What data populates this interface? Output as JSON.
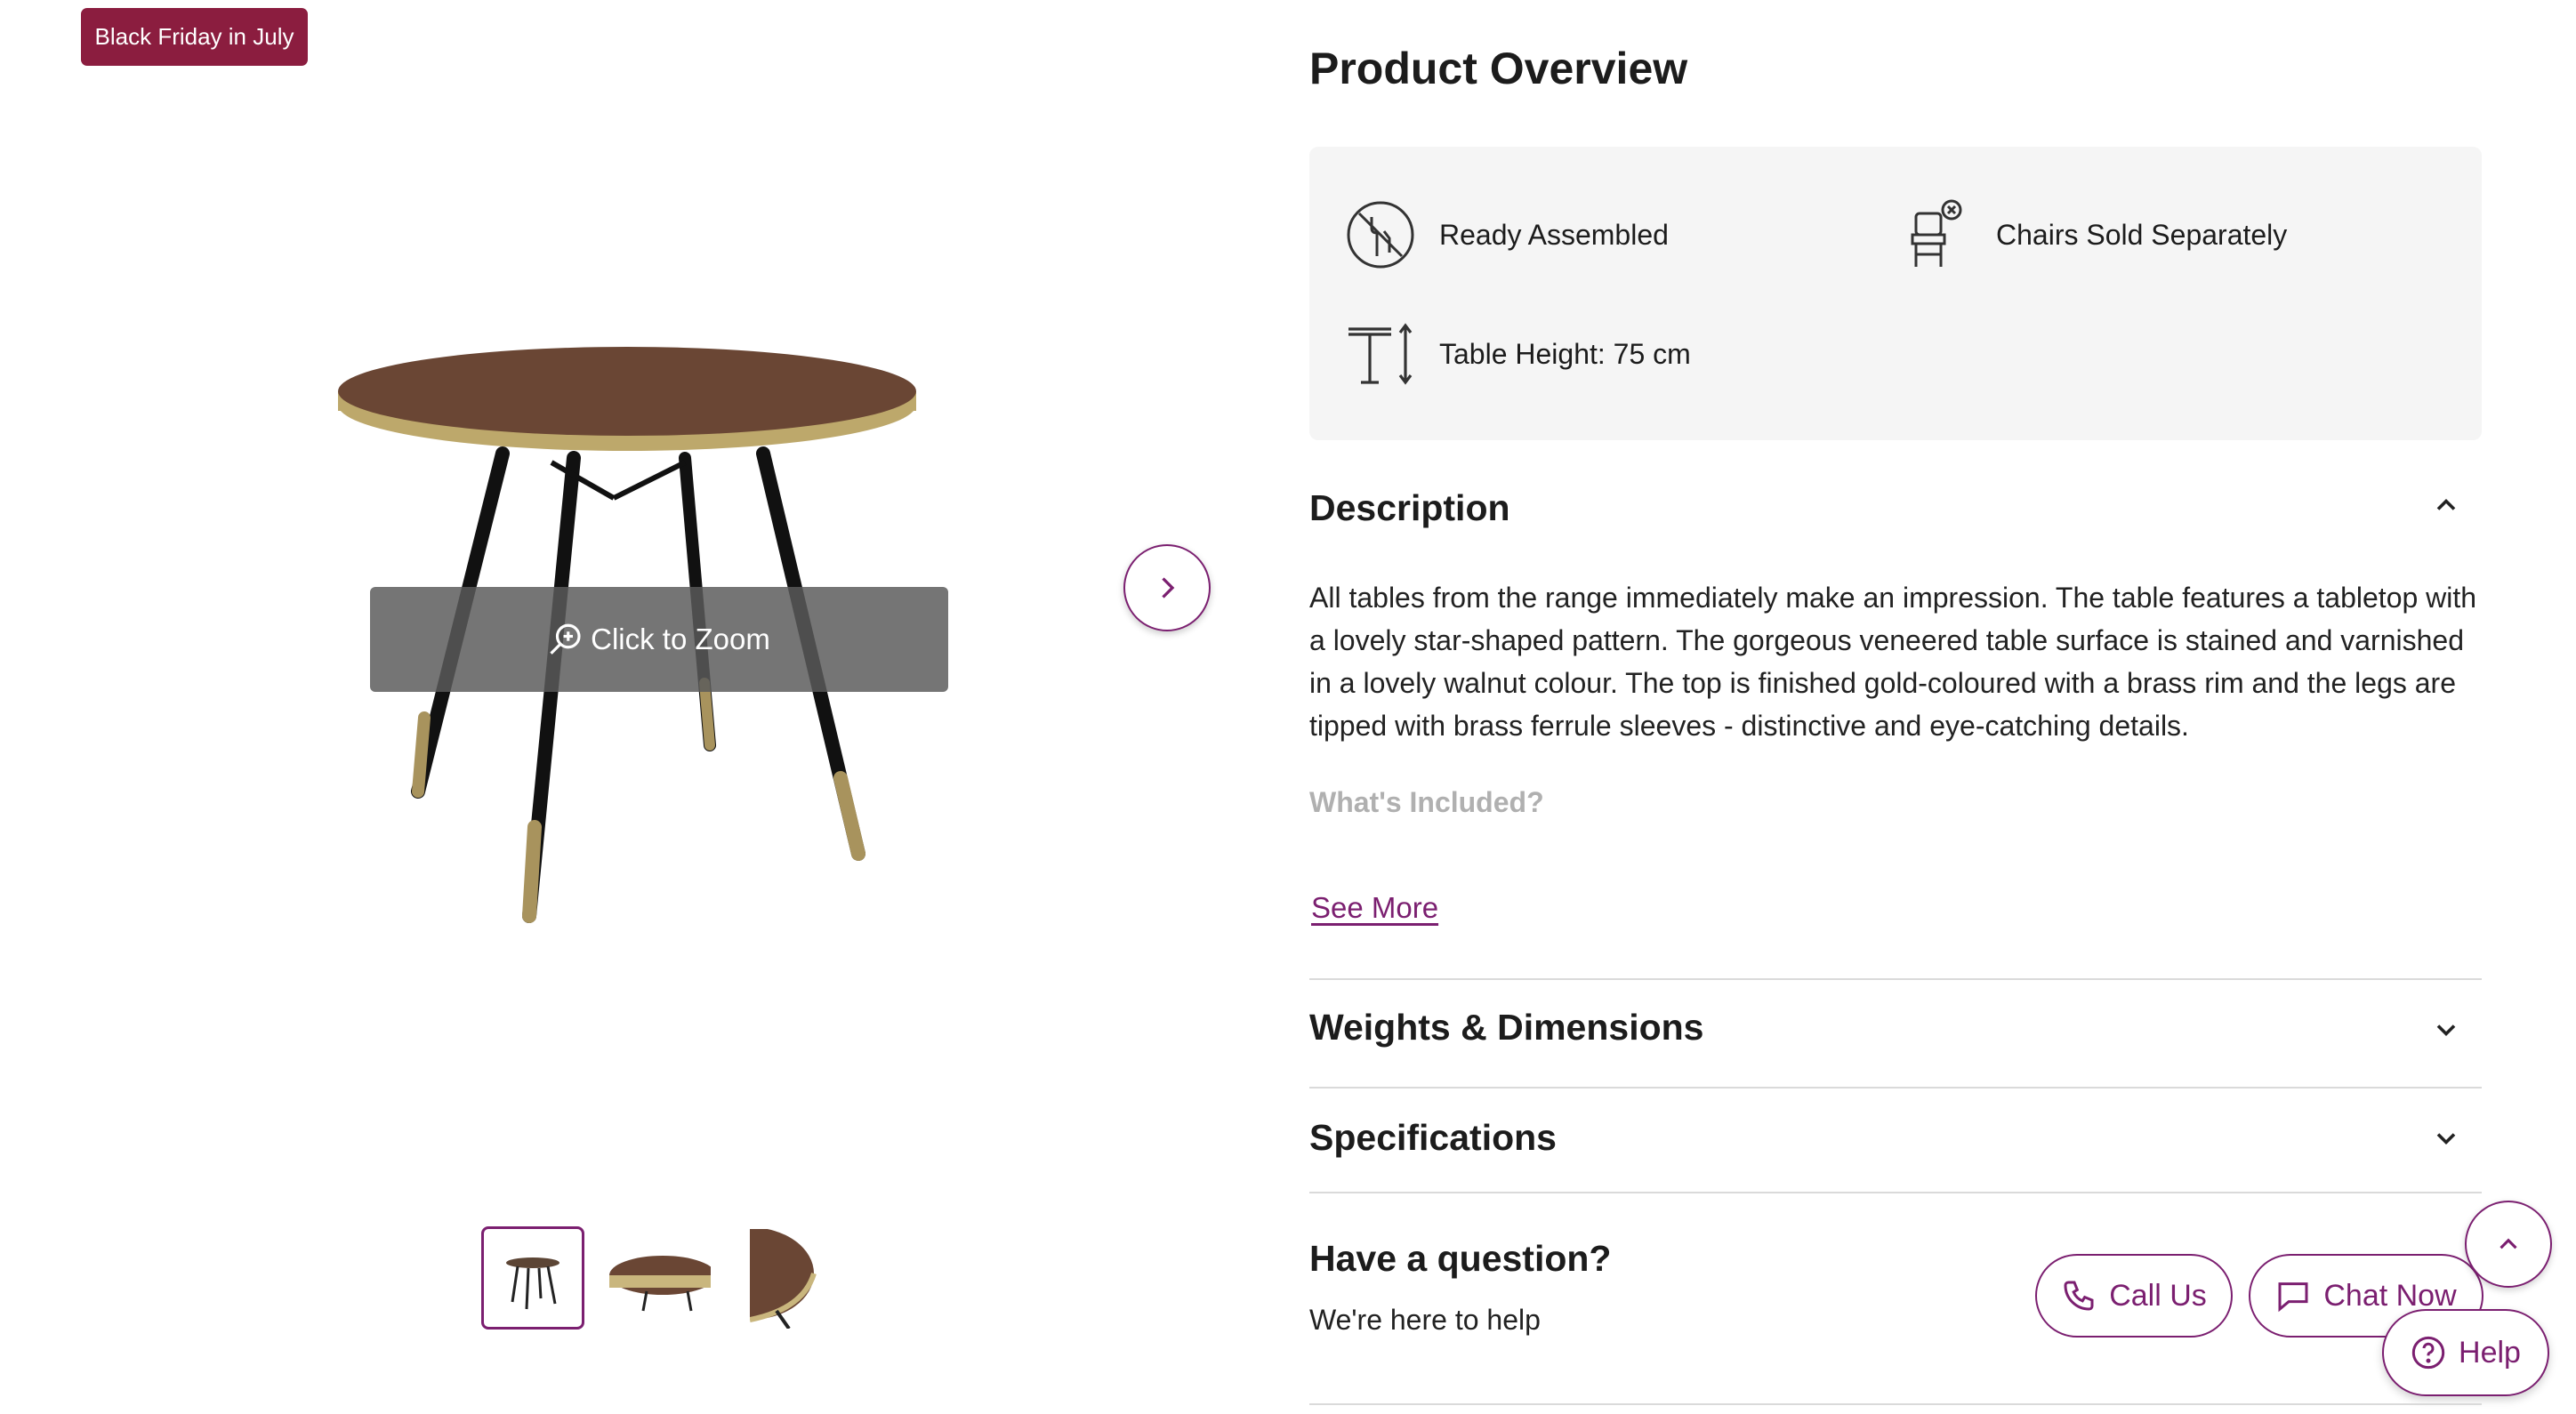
{
  "badge": "Black Friday in July",
  "gallery": {
    "zoom_label": "Click to Zoom",
    "thumbnails": [
      "table-full",
      "table-top",
      "table-edge"
    ]
  },
  "overview": {
    "title": "Product Overview",
    "features": [
      {
        "icon": "tools-crossed-icon",
        "label": "Ready Assembled"
      },
      {
        "icon": "chair-excluded-icon",
        "label": "Chairs Sold Separately"
      },
      {
        "icon": "table-height-icon",
        "label": "Table Height: 75 cm"
      }
    ]
  },
  "description": {
    "title": "Description",
    "text": "All tables from the range immediately make an impression. The table features a tabletop with a lovely star-shaped pattern. The gorgeous veneered table surface is stained and varnished in a lovely walnut colour. The top is finished gold-coloured with a brass rim and the legs are tipped with brass ferrule sleeves - distinctive and eye-catching details.",
    "included_heading": "What's Included?",
    "see_more": "See More"
  },
  "sections": {
    "weights": "Weights & Dimensions",
    "specifications": "Specifications"
  },
  "question": {
    "title": "Have a question?",
    "subtitle": "We're here to help",
    "call_label": "Call Us",
    "chat_label": "Chat Now",
    "help_label": "Help"
  },
  "colors": {
    "brand": "#7b1f70",
    "badge": "#8b1d3f",
    "panel": "#f5f5f5"
  }
}
